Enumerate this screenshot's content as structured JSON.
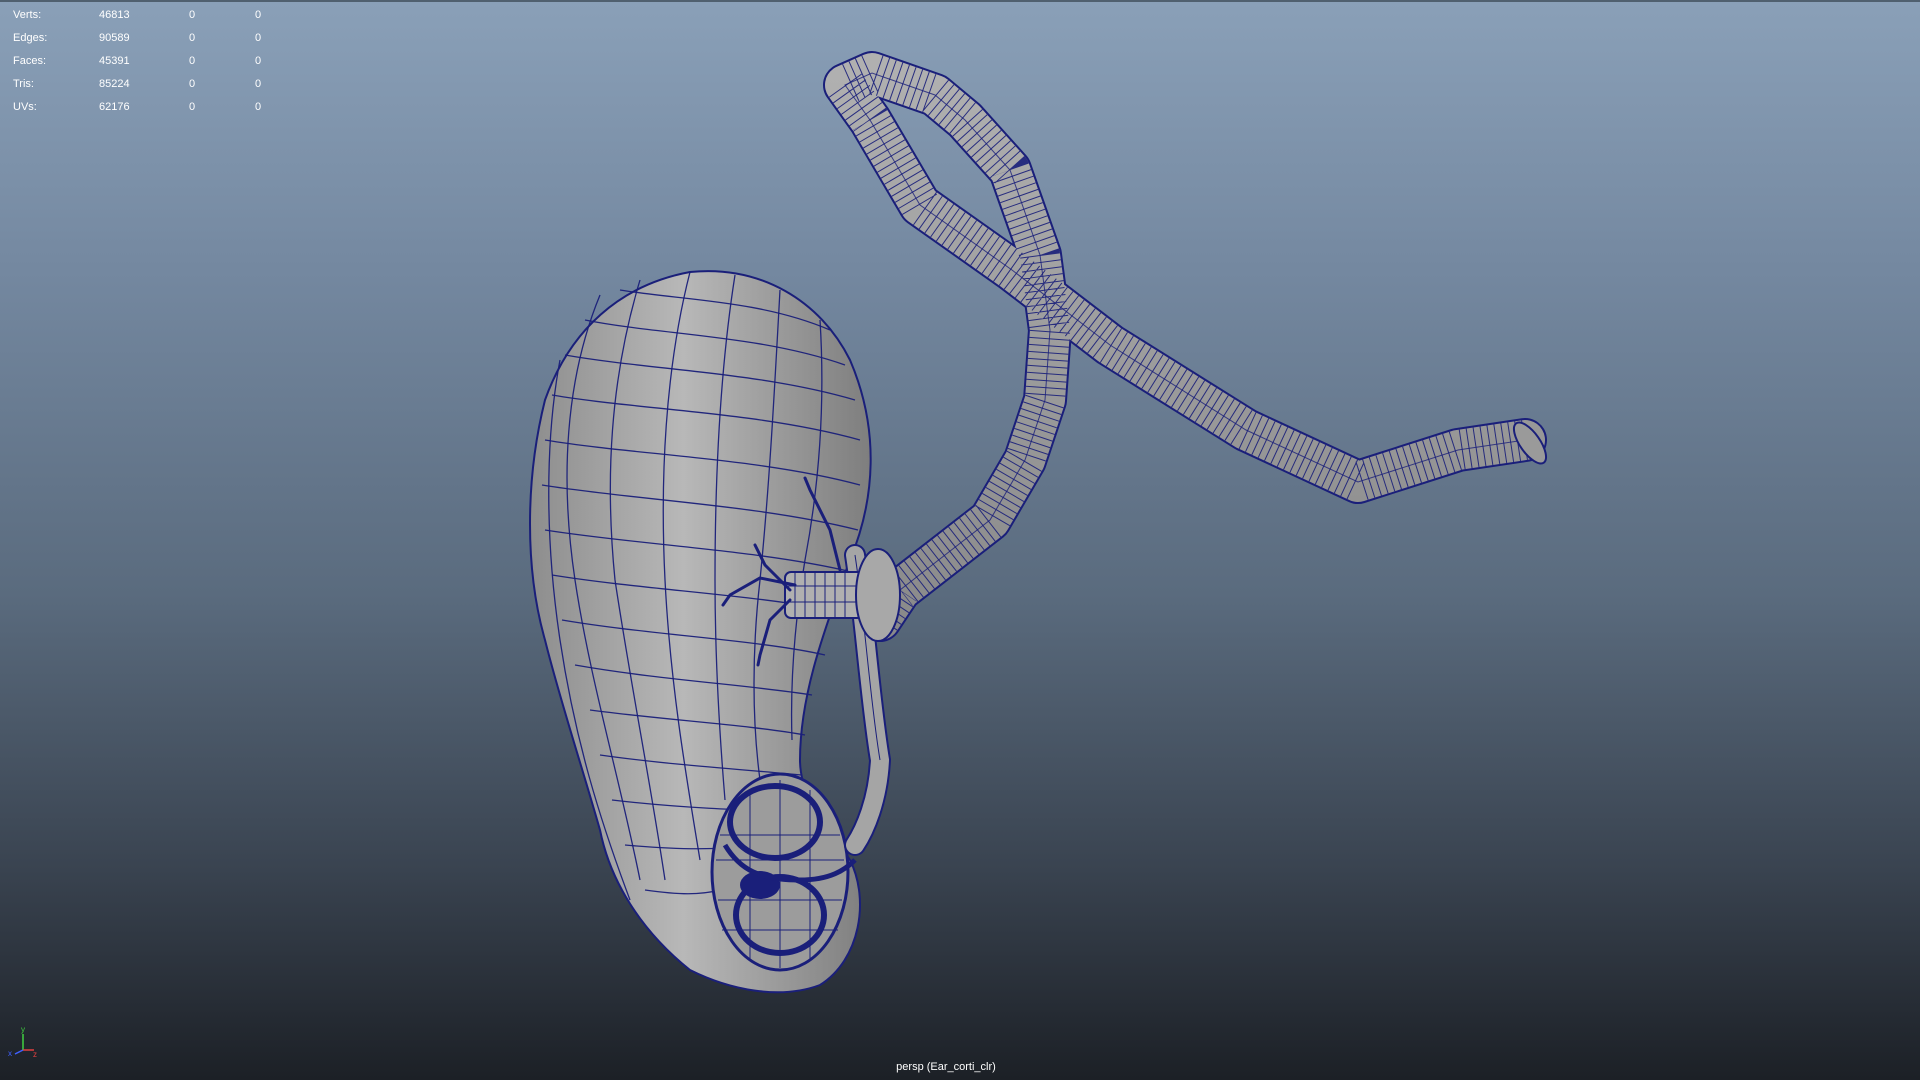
{
  "hud": {
    "rows": [
      {
        "label": "Verts:",
        "total": "46813",
        "selected": "0",
        "selected2": "0"
      },
      {
        "label": "Edges:",
        "total": "90589",
        "selected": "0",
        "selected2": "0"
      },
      {
        "label": "Faces:",
        "total": "45391",
        "selected": "0",
        "selected2": "0"
      },
      {
        "label": "Tris:",
        "total": "85224",
        "selected": "0",
        "selected2": "0"
      },
      {
        "label": "UVs:",
        "total": "62176",
        "selected": "0",
        "selected2": "0"
      }
    ]
  },
  "viewport": {
    "camera_label": "persp (Ear_corti_clr)",
    "wireframe_color": "#1a1f7a",
    "mesh_fill": "#a8a8a8",
    "background_top": "#8aa0b8",
    "background_bottom": "#1c2026"
  },
  "axis_gizmo": {
    "x_label": "x",
    "y_label": "y",
    "z_label": "z",
    "x_color": "#e04040",
    "y_color": "#40d040",
    "z_color": "#4060ff"
  }
}
